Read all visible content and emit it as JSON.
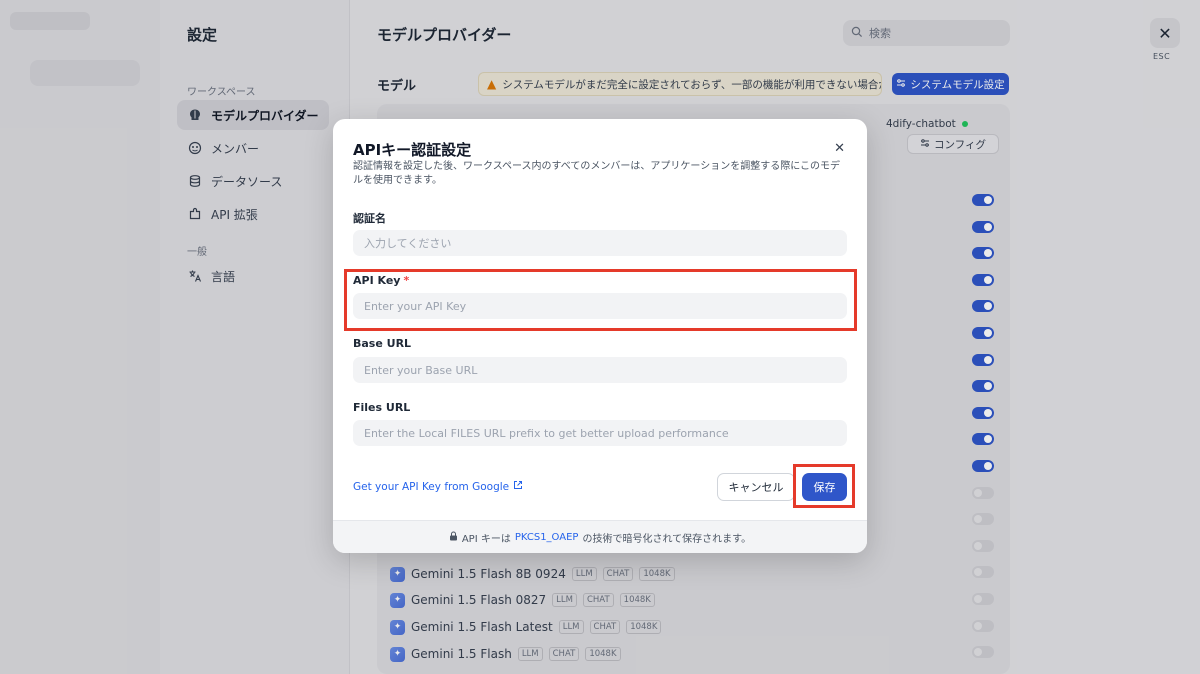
{
  "settings": {
    "title": "設定",
    "sidebar": {
      "section_workspace": "ワークスペース",
      "section_general": "一般",
      "items": [
        {
          "label": "モデルプロバイダー",
          "icon": "brain-icon"
        },
        {
          "label": "メンバー",
          "icon": "members-icon"
        },
        {
          "label": "データソース",
          "icon": "database-icon"
        },
        {
          "label": "API 拡張",
          "icon": "puzzle-icon"
        },
        {
          "label": "言語",
          "icon": "translate-icon"
        }
      ]
    }
  },
  "main": {
    "title": "モデルプロバイダー",
    "search_placeholder": "検索",
    "model_label": "モデル",
    "warning": "システムモデルがまだ完全に設定されておらず、一部の機能が利用できない場合が...",
    "system_model_button": "システムモデル設定",
    "provider": {
      "credential_name": "4dify-chatbot",
      "config_button": "コンフィグ"
    },
    "models": [
      {
        "name": "Gemini 1.5 Flash 8B 0924",
        "tags": [
          "LLM",
          "CHAT",
          "1048K"
        ]
      },
      {
        "name": "Gemini 1.5 Flash 0827",
        "tags": [
          "LLM",
          "CHAT",
          "1048K"
        ]
      },
      {
        "name": "Gemini 1.5 Flash Latest",
        "tags": [
          "LLM",
          "CHAT",
          "1048K"
        ]
      },
      {
        "name": "Gemini 1.5 Flash",
        "tags": [
          "LLM",
          "CHAT",
          "1048K"
        ]
      }
    ],
    "toggles": [
      true,
      true,
      true,
      true,
      true,
      true,
      true,
      true,
      true,
      true,
      true,
      false,
      false,
      false,
      false,
      false,
      false,
      false
    ]
  },
  "close": {
    "esc_label": "ESC"
  },
  "modal": {
    "title": "APIキー認証設定",
    "description": "認証情報を設定した後、ワークスペース内のすべてのメンバーは、アプリケーションを調整する際にこのモデルを使用できます。",
    "fields": {
      "credential_name": {
        "label": "認証名",
        "placeholder": "入力してください"
      },
      "api_key": {
        "label": "API Key",
        "required_mark": "*",
        "placeholder": "Enter your API Key"
      },
      "base_url": {
        "label": "Base URL",
        "placeholder": "Enter your Base URL"
      },
      "files_url": {
        "label": "Files URL",
        "placeholder": "Enter the Local FILES URL prefix to get better upload performance"
      }
    },
    "google_link": "Get your API Key from Google",
    "cancel_label": "キャンセル",
    "save_label": "保存",
    "footer": {
      "prefix": "API キーは",
      "link": "PKCS1_OAEP",
      "suffix": "の技術で暗号化されて保存されます。"
    }
  },
  "colors": {
    "accent": "#2f56c9",
    "highlight": "#e53a2a",
    "warning": "#d97706"
  }
}
